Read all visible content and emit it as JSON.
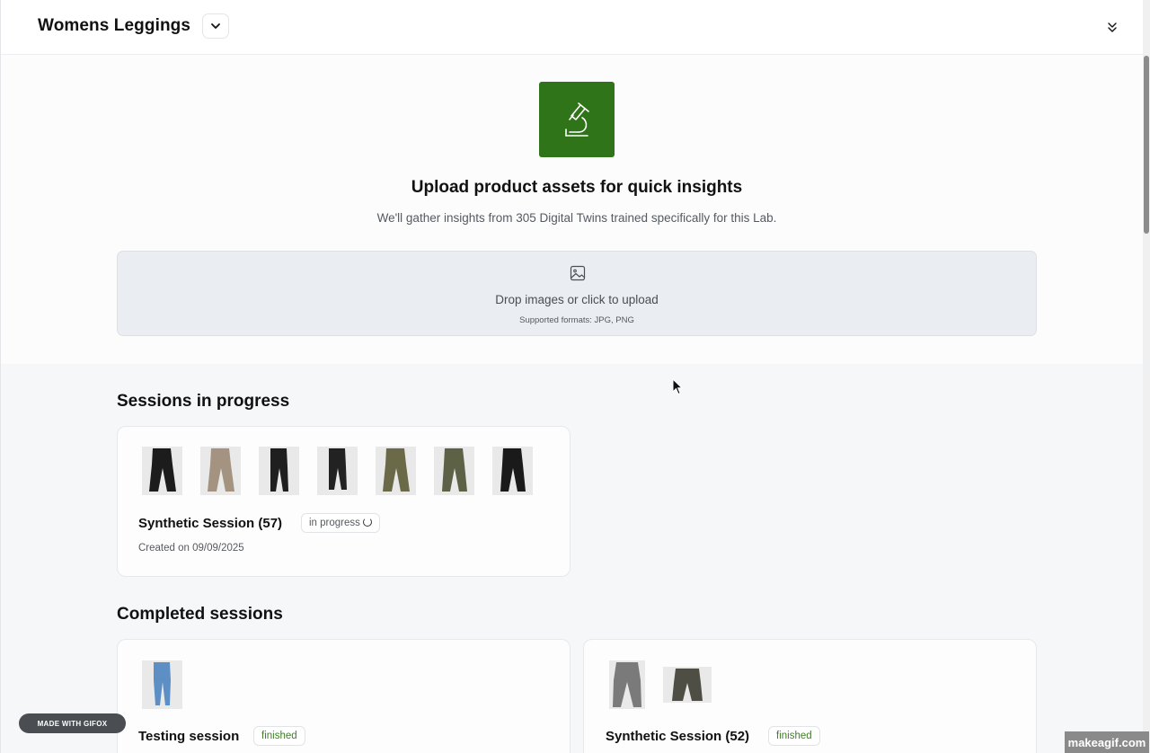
{
  "header": {
    "lab_name": "Womens Leggings"
  },
  "hero": {
    "title": "Upload product assets for quick insights",
    "subtitle": "We'll gather insights from 305 Digital Twins trained specifically for this Lab."
  },
  "upload": {
    "prompt": "Drop images or click to upload",
    "formats": "Supported formats: JPG, PNG"
  },
  "in_progress": {
    "heading": "Sessions in progress",
    "sessions": [
      {
        "name": "Synthetic Session (57)",
        "status": "in progress",
        "created": "Created on 09/09/2025",
        "thumbnails": [
          "#1c1c1c",
          "#a39380",
          "#1f1f1f",
          "#222222",
          "#6b6a48",
          "#5d6247",
          "#1a1a1a"
        ]
      }
    ]
  },
  "completed": {
    "heading": "Completed sessions",
    "sessions": [
      {
        "name": "Testing session",
        "status": "finished",
        "thumbnails": [
          "#5d8fc4"
        ]
      },
      {
        "name": "Synthetic Session (52)",
        "status": "finished",
        "thumbnails": [
          "#7a7a7a",
          "#4e4e44"
        ]
      }
    ]
  },
  "watermarks": {
    "gifox": "MADE WITH GIFOX",
    "makeagif": "makeagif.com"
  },
  "colors": {
    "accent": "#2f7418",
    "finished": "#3f7d2a"
  }
}
